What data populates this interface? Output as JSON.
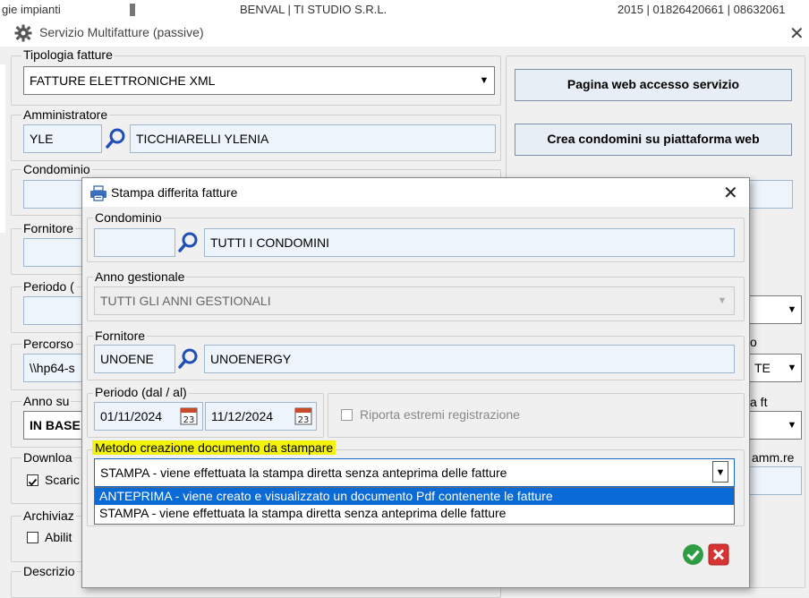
{
  "background_strip": {
    "left": "gie impianti",
    "middle": "BENVAL | TI STUDIO S.R.L.",
    "right": "2015 | 01826420661 | 08632061"
  },
  "main_window": {
    "title": "Servizio Multifatture (passive)",
    "tipologia": {
      "label": "Tipologia fatture",
      "value": "FATTURE ELETTRONICHE XML"
    },
    "amministratore": {
      "label": "Amministratore",
      "code": "YLE",
      "name": "TICCHIARELLI YLENIA"
    },
    "condominio_label": "Condominio",
    "fornitore_label": "Fornitore",
    "periodo_label": "Periodo (",
    "percorso": {
      "label": "Percorso",
      "value": "\\\\hp64-s"
    },
    "anno": {
      "label": "Anno su",
      "value": "IN BASE"
    },
    "download": {
      "label": "Downloa",
      "checkbox_label": "Scaric",
      "checked": true
    },
    "archivia": {
      "label": "Archiviaz",
      "checkbox_label": "Abilit",
      "checked": false
    },
    "descrizione_label": "Descrizio",
    "right_buttons": {
      "pagina_web": "Pagina web accesso servizio",
      "crea_condomini": "Crea condomini su piattaforma web"
    },
    "right_fragments": {
      "select_r2_value": "TE",
      "label_o": "o",
      "label_ft": "a ft",
      "label_amm": "amm.re"
    }
  },
  "dialog": {
    "title": "Stampa differita fatture",
    "condominio": {
      "label": "Condominio",
      "code": "",
      "name": "TUTTI I CONDOMINI"
    },
    "anno_gestionale": {
      "label": "Anno gestionale",
      "value": "TUTTI GLI ANNI GESTIONALI"
    },
    "fornitore": {
      "label": "Fornitore",
      "code": "UNOENE",
      "name": "UNOENERGY"
    },
    "periodo": {
      "label": "Periodo (dal / al)",
      "dal": "01/11/2024",
      "al": "11/12/2024"
    },
    "riporta_label": "Riporta estremi registrazione",
    "metodo": {
      "label": "Metodo creazione documento da stampare",
      "selected": "STAMPA - viene effettuata la stampa diretta senza anteprima delle fatture",
      "options": [
        "ANTEPRIMA - viene creato e visualizzato un documento Pdf contenente le fatture",
        "STAMPA - viene effettuata la stampa diretta senza anteprima delle fatture"
      ]
    }
  },
  "colors": {
    "highlight": "#f2f20a",
    "selection": "#0a6ad6",
    "ok": "#2e9d44",
    "cancel": "#d73333"
  }
}
